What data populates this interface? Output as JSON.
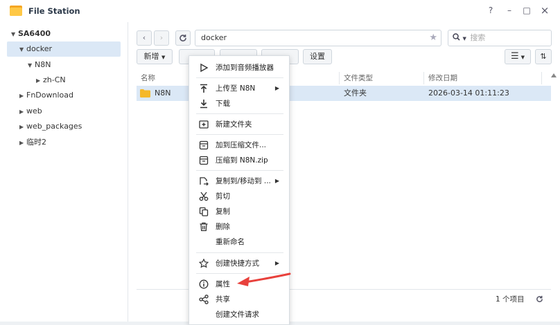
{
  "app": {
    "title": "File Station",
    "help": "?",
    "minimize": "–",
    "maximize": "□",
    "close": "×"
  },
  "sidebar": {
    "root": "SA6400",
    "items": [
      {
        "label": "docker"
      },
      {
        "label": "N8N"
      },
      {
        "label": "zh-CN"
      },
      {
        "label": "FnDownload"
      },
      {
        "label": "web"
      },
      {
        "label": "web_packages"
      },
      {
        "label": "临时2"
      }
    ]
  },
  "toolbar": {
    "back": "‹",
    "forward": "›",
    "refresh": "C",
    "path": "docker",
    "search_placeholder": "搜索",
    "new_label": "新增",
    "settings_label": "设置"
  },
  "table": {
    "columns": [
      "名称",
      "文件类型",
      "修改日期"
    ],
    "rows": [
      {
        "name": "N8N",
        "type": "文件夹",
        "modified": "2026-03-14 01:11:23"
      }
    ],
    "footer_count": "1 个项目"
  },
  "context_menu": {
    "items": [
      {
        "label": "添加到音频播放器"
      },
      {
        "label": "上传至 N8N"
      },
      {
        "label": "下载"
      },
      {
        "label": "新建文件夹"
      },
      {
        "label": "加到压缩文件..."
      },
      {
        "label": "压缩到 N8N.zip"
      },
      {
        "label": "复制到/移动到 ..."
      },
      {
        "label": "剪切"
      },
      {
        "label": "复制"
      },
      {
        "label": "删除"
      },
      {
        "label": "重新命名"
      },
      {
        "label": "创建快捷方式"
      },
      {
        "label": "属性"
      },
      {
        "label": "共享"
      },
      {
        "label": "创建文件请求"
      }
    ]
  },
  "colors": {
    "selection": "#dbe8f6",
    "annotation_arrow": "#e8413c",
    "folder": "#f5b829"
  }
}
